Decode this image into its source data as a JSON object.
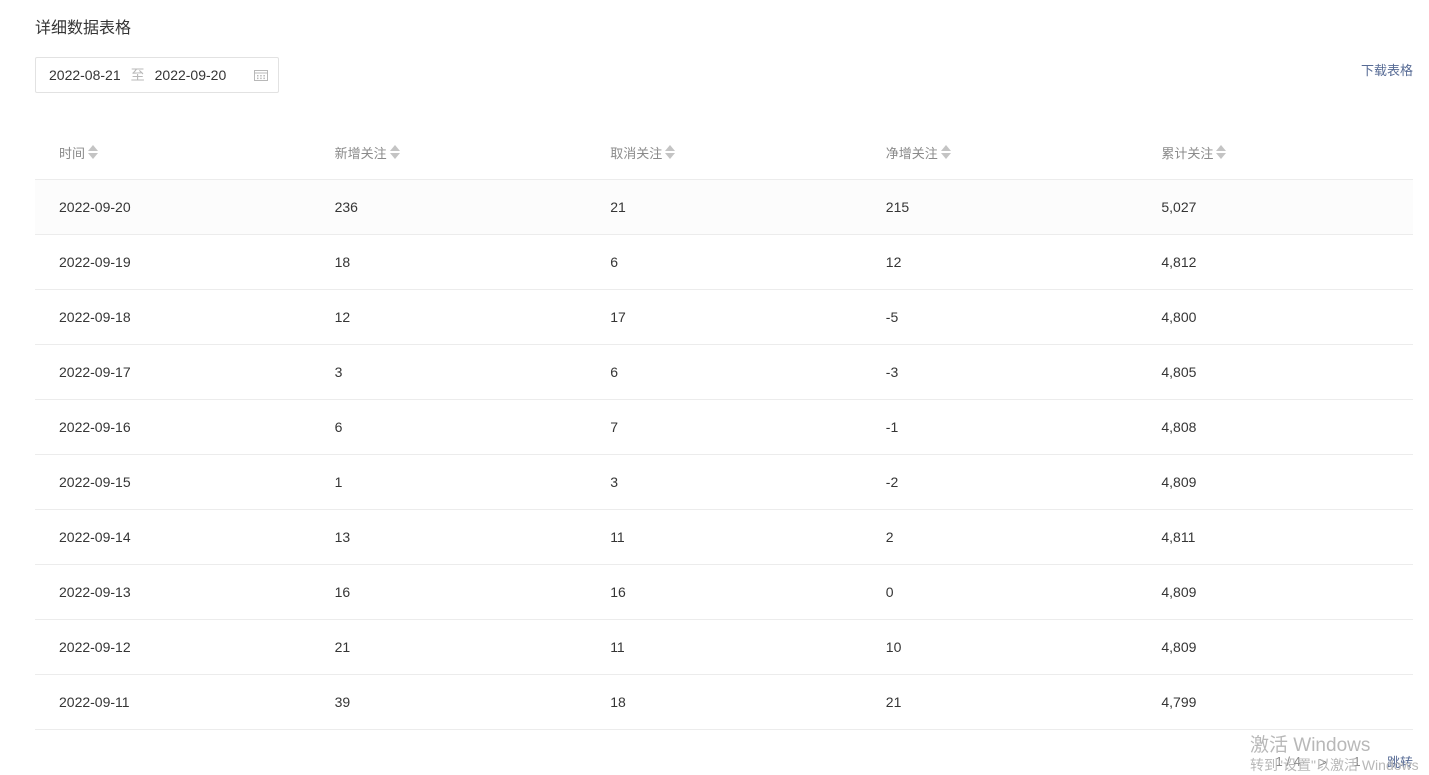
{
  "section": {
    "title": "详细数据表格"
  },
  "date_range": {
    "start": "2022-08-21",
    "separator": "至",
    "end": "2022-09-20"
  },
  "toolbar": {
    "download_label": "下载表格"
  },
  "table": {
    "columns": [
      "时间",
      "新增关注",
      "取消关注",
      "净增关注",
      "累计关注"
    ],
    "rows": [
      [
        "2022-09-20",
        "236",
        "21",
        "215",
        "5,027"
      ],
      [
        "2022-09-19",
        "18",
        "6",
        "12",
        "4,812"
      ],
      [
        "2022-09-18",
        "12",
        "17",
        "-5",
        "4,800"
      ],
      [
        "2022-09-17",
        "3",
        "6",
        "-3",
        "4,805"
      ],
      [
        "2022-09-16",
        "6",
        "7",
        "-1",
        "4,808"
      ],
      [
        "2022-09-15",
        "1",
        "3",
        "-2",
        "4,809"
      ],
      [
        "2022-09-14",
        "13",
        "11",
        "2",
        "4,811"
      ],
      [
        "2022-09-13",
        "16",
        "16",
        "0",
        "4,809"
      ],
      [
        "2022-09-12",
        "21",
        "11",
        "10",
        "4,809"
      ],
      [
        "2022-09-11",
        "39",
        "18",
        "21",
        "4,799"
      ]
    ]
  },
  "pagination": {
    "page_info": "1 / 4",
    "next_symbol": ">",
    "jump_value": "1",
    "jump_label": "跳转"
  },
  "watermark": {
    "line1": "激活 Windows",
    "line2": "转到\"设置\"以激活 Windows"
  }
}
